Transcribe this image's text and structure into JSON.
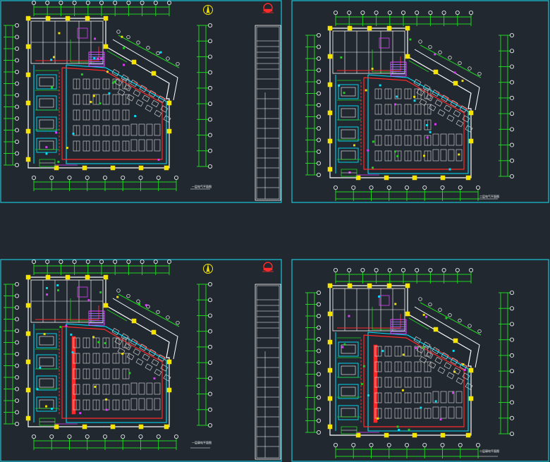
{
  "canvas": {
    "background": "#212830"
  },
  "colors": {
    "frame": "#19c6d6",
    "wall": "#ffffff",
    "red": "#ff2a2a",
    "cyan": "#00e5ff",
    "green": "#1fd31f",
    "yellow": "#f4e400",
    "magenta": "#e23cff",
    "purple": "#a06cff",
    "seat": "#c9c9c9",
    "bluegrey": "#6b7f9a"
  },
  "sheets": [
    {
      "id": "sheet-1",
      "north_arrow": true,
      "title_block": true,
      "caption": "一层电气平面图"
    },
    {
      "id": "sheet-2",
      "north_arrow": false,
      "title_block": false,
      "caption": "二层电气平面图"
    },
    {
      "id": "sheet-3",
      "north_arrow": true,
      "title_block": true,
      "caption": "一层弱电平面图"
    },
    {
      "id": "sheet-4",
      "north_arrow": false,
      "title_block": false,
      "caption": "二层弱电平面图"
    }
  ]
}
